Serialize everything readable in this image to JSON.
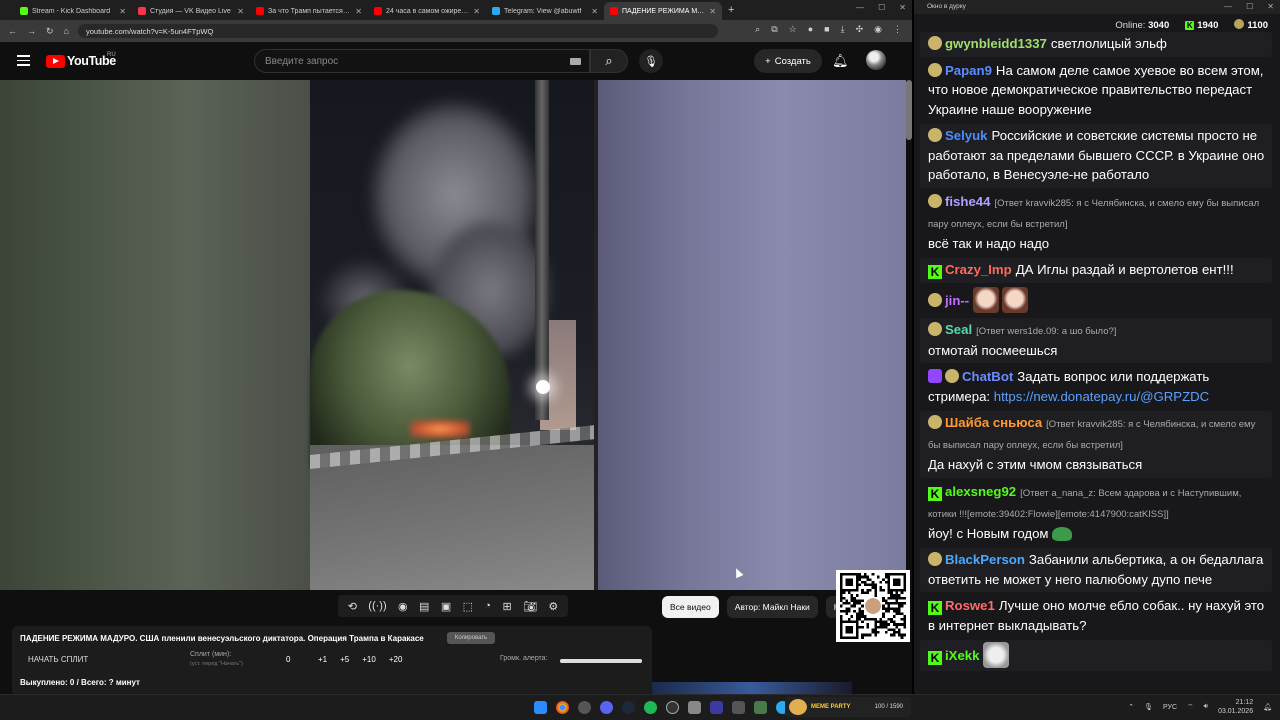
{
  "browser": {
    "tabs": [
      {
        "title": "Stream - Kick Dashboard",
        "color": "#53fc18"
      },
      {
        "title": "Студия — VK Видео Live",
        "color": "#ff3347"
      },
      {
        "title": "За что Трамп пытается убить",
        "color": "#ff0000"
      },
      {
        "title": "24 часа в самом ожиревшем",
        "color": "#ff0000"
      },
      {
        "title": "Telegram: View @abuwtf",
        "color": "#2aabee"
      },
      {
        "title": "ПАДЕНИЕ РЕЖИМА МАДУРО",
        "color": "#ff0000"
      }
    ],
    "url": "youtube.com/watch?v=K-5un4FTpWQ"
  },
  "youtube": {
    "logo_text": "YouTube",
    "region": "RU",
    "search_placeholder": "Введите запрос",
    "create_label": "Создать"
  },
  "panel": {
    "title": "ПАДЕНИЕ РЕЖИМА МАДУРО. США пленили венесуэльского диктатора. Операция Трампа в Каракасе",
    "copy_chip": "Копировать",
    "start_split": "НАЧАТЬ СПЛИТ",
    "split_label": "Сплит (мин):",
    "split_hint": "(уст. перед \"Начать\")",
    "split_value": "0",
    "increments": [
      "+1",
      "+5",
      "+10",
      "+20"
    ],
    "alert_label": "Громк. алерта:",
    "alert_level": 1.0,
    "bought": "Выкуплено: 0 / Всего: ? минут"
  },
  "chips": [
    "Все видео",
    "Автор: Майкл Наки",
    "Н"
  ],
  "chat": {
    "window_title": "Окно в дурку",
    "online_label": "Online:",
    "online_value": "3040",
    "kick_count": "1940",
    "yt_count": "1100",
    "messages": [
      {
        "name": "gwynbleidd1337",
        "color": "#9ee06a",
        "badge": "yt",
        "text": "светлолицый эльф",
        "reply": ""
      },
      {
        "name": "Papan9",
        "color": "#5b8cff",
        "badge": "yt",
        "text": "На самом деле самое хуевое во всем этом, что новое демократическое правительство передаст Украине наше вооружение",
        "reply": ""
      },
      {
        "name": "Selyuk",
        "color": "#4b8cff",
        "badge": "yt",
        "text": "Российские и советские системы просто не работают за пределами бывшего СССР. в Украине оно работало, в Венесуэле-не работало",
        "reply": ""
      },
      {
        "name": "fishe44",
        "color": "#b0a0ff",
        "badge": "yt",
        "text": "всё так и надо надо",
        "reply": "[Ответ kravvik285: я с Челябинска, и смело ему бы выписал пару оплеух, если бы встретил]"
      },
      {
        "name": "Crazy_Imp",
        "color": "#ff6a5a",
        "badge": "kick",
        "text": "ДА Иглы раздай и вертолетов ент!!!",
        "reply": ""
      },
      {
        "name": "jin--",
        "color": "#c070ff",
        "badge": "yt",
        "text": "",
        "reply": "",
        "emotes": 2
      },
      {
        "name": "Seal",
        "color": "#5ad6b0",
        "badge": "yt",
        "text": "отмотай посмеешься",
        "reply": "[Ответ wers1de.09: а шо было?]"
      },
      {
        "name": "ChatBot",
        "color": "#6a8cff",
        "badge": "bot",
        "text": "Задать вопрос или поддержать стримера:",
        "link": "https://new.donatepay.ru/@GRPZDC",
        "reply": ""
      },
      {
        "name": "Шайба сньюса",
        "color": "#ff9a30",
        "badge": "yt",
        "text": "Да нахуй с этим чмом связываться",
        "reply": "[Ответ kravvik285: я с Челябинска, и смело ему бы выписал пару оплеух, если бы встретил]"
      },
      {
        "name": "alexsneg92",
        "color": "#53fc18",
        "badge": "kick",
        "text": "йоу! с Новым годом",
        "reply": "[Ответ a_nana_z: Всем здарова и с Наступившим, котики !!![emote:39402:Flowie][emote:4147900:catKISS]]"
      },
      {
        "name": "BlackPerson",
        "color": "#4aa8ff",
        "badge": "yt",
        "text": "Забанили альбертика, а он бедаллага ответить не может у него палюбому дупо пече",
        "reply": ""
      },
      {
        "name": "Roswe1",
        "color": "#ff6a6a",
        "badge": "kick",
        "text": "Лучше оно молче ебло собак.. ну нахуй это в интернет выкладывать?",
        "reply": ""
      },
      {
        "name": "iXekk",
        "color": "#53fc18",
        "badge": "kick",
        "text": "",
        "reply": "",
        "cat": true
      }
    ]
  },
  "taskbar": {
    "memes_title": "MEME PARTY",
    "memes_count": "100 / 1590",
    "lang": "РУС",
    "time": "21:12",
    "date": "03.01.2026"
  }
}
